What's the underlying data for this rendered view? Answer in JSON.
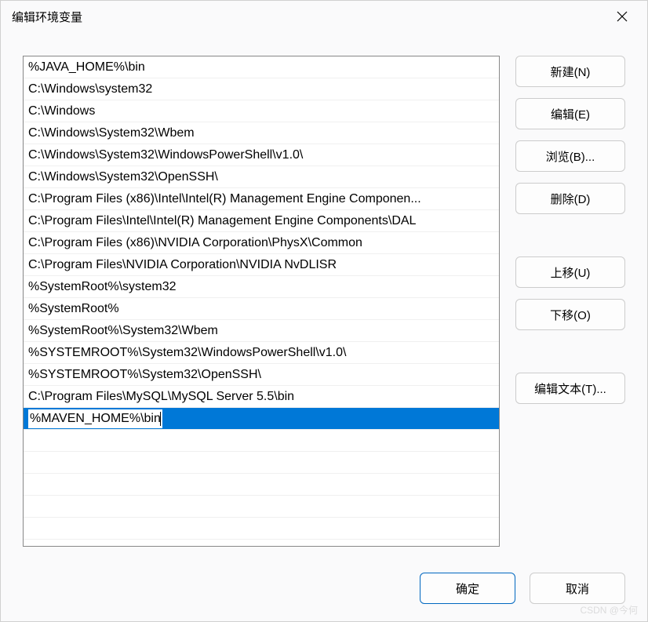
{
  "window": {
    "title": "编辑环境变量"
  },
  "list": {
    "items": [
      "%JAVA_HOME%\\bin",
      "C:\\Windows\\system32",
      "C:\\Windows",
      "C:\\Windows\\System32\\Wbem",
      "C:\\Windows\\System32\\WindowsPowerShell\\v1.0\\",
      "C:\\Windows\\System32\\OpenSSH\\",
      "C:\\Program Files (x86)\\Intel\\Intel(R) Management Engine Componen...",
      "C:\\Program Files\\Intel\\Intel(R) Management Engine Components\\DAL",
      "C:\\Program Files (x86)\\NVIDIA Corporation\\PhysX\\Common",
      "C:\\Program Files\\NVIDIA Corporation\\NVIDIA NvDLISR",
      "%SystemRoot%\\system32",
      "%SystemRoot%",
      "%SystemRoot%\\System32\\Wbem",
      "%SYSTEMROOT%\\System32\\WindowsPowerShell\\v1.0\\",
      "%SYSTEMROOT%\\System32\\OpenSSH\\",
      "C:\\Program Files\\MySQL\\MySQL Server 5.5\\bin",
      "%MAVEN_HOME%\\bin"
    ],
    "selected_index": 16,
    "edit_value": "%MAVEN_HOME%\\bin"
  },
  "buttons": {
    "new": "新建(N)",
    "edit": "编辑(E)",
    "browse": "浏览(B)...",
    "delete": "删除(D)",
    "move_up": "上移(U)",
    "move_down": "下移(O)",
    "edit_text": "编辑文本(T)...",
    "ok": "确定",
    "cancel": "取消"
  },
  "watermark": "CSDN @今何"
}
